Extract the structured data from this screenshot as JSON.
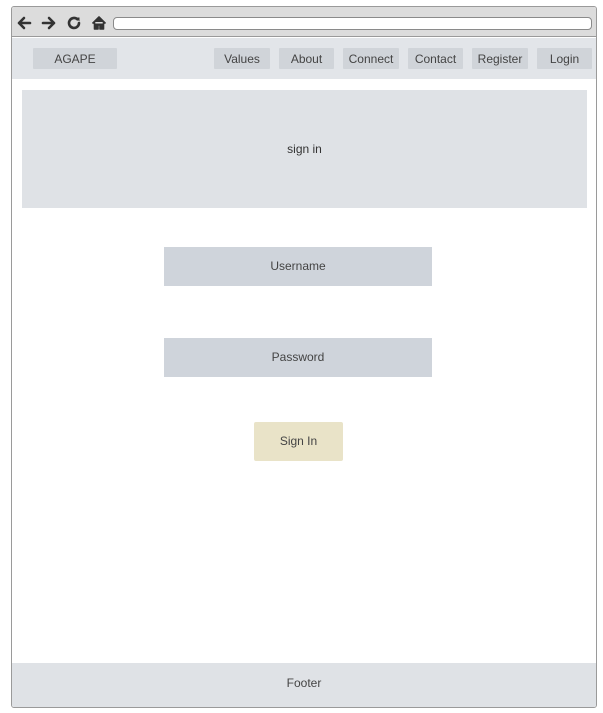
{
  "browser": {
    "back_icon": "arrow-left-icon",
    "forward_icon": "arrow-right-icon",
    "reload_icon": "reload-icon",
    "home_icon": "home-icon",
    "url": ""
  },
  "navbar": {
    "brand": "AGAPE",
    "items": [
      {
        "label": "Values"
      },
      {
        "label": "About"
      },
      {
        "label": "Connect"
      },
      {
        "label": "Contact"
      },
      {
        "label": "Register"
      },
      {
        "label": "Login"
      }
    ]
  },
  "hero": {
    "title": "sign in"
  },
  "form": {
    "username_label": "Username",
    "password_label": "Password",
    "submit_label": "Sign In"
  },
  "footer": {
    "text": "Footer"
  },
  "colors": {
    "panel": "#dfe2e6",
    "field": "#cfd4db",
    "button": "#e9e3c8",
    "toolbar": "#dcdcdc"
  }
}
